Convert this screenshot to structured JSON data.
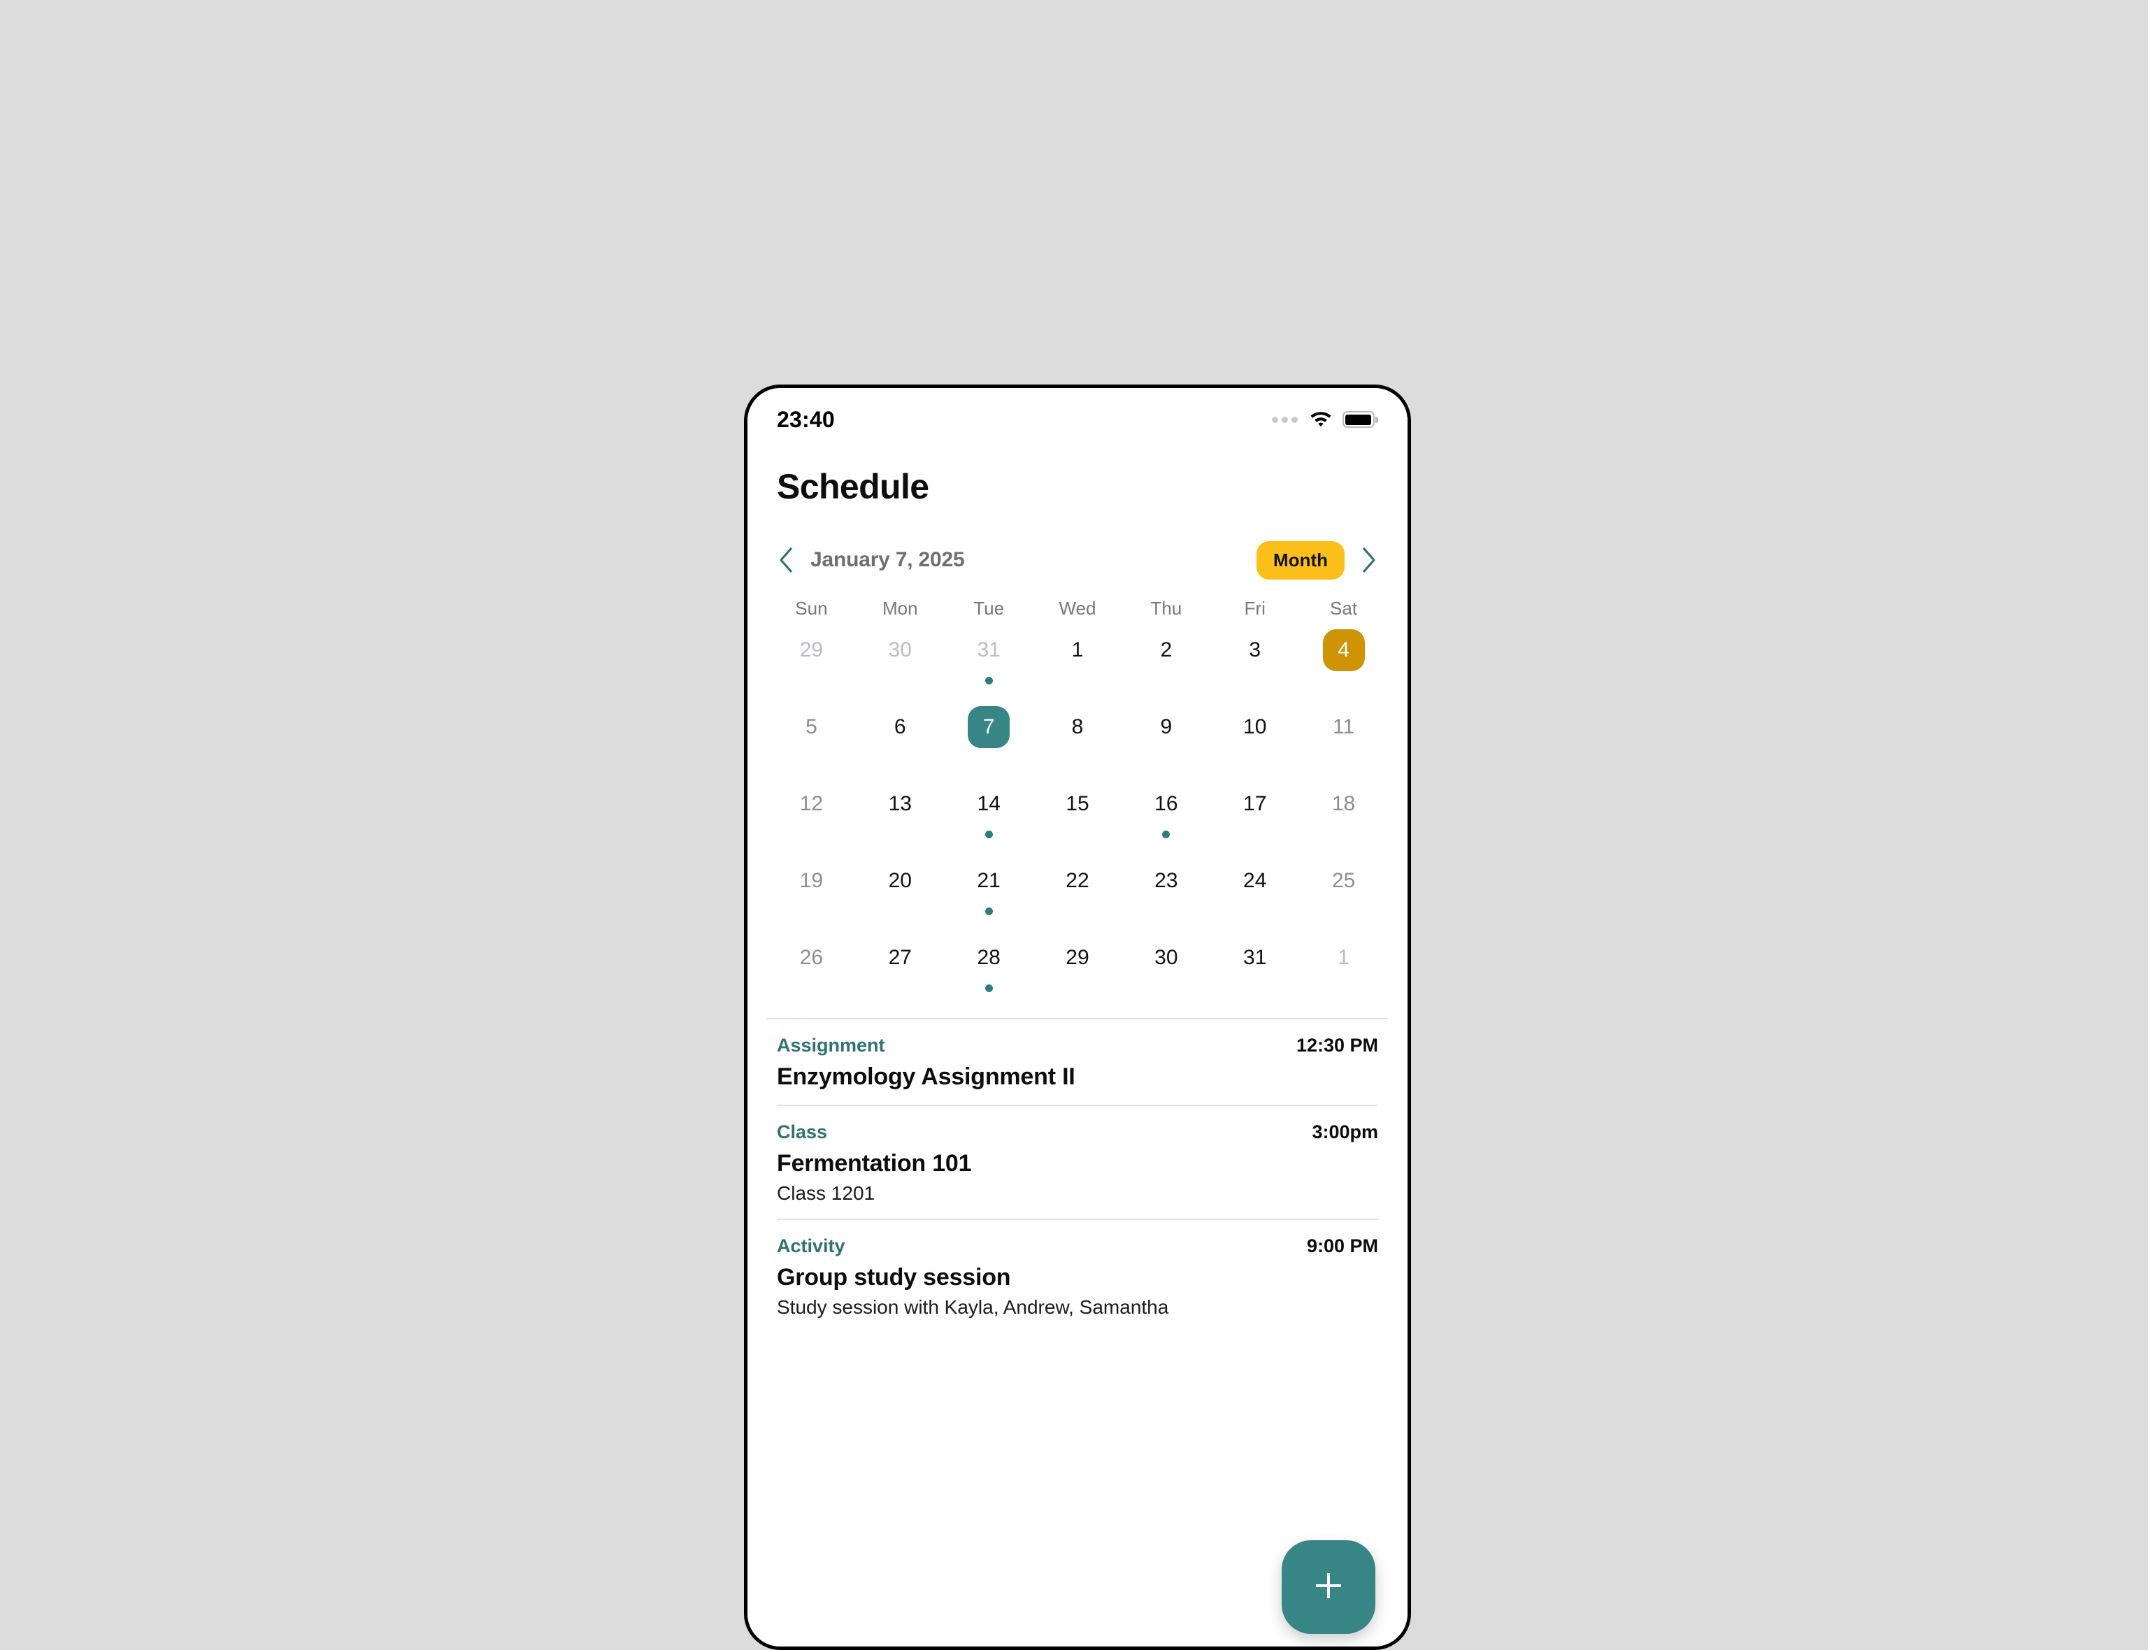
{
  "status_bar": {
    "time": "23:40",
    "signal_icon": "cellular-dots-icon",
    "wifi_icon": "wifi-icon",
    "battery_icon": "battery-full-icon"
  },
  "header": {
    "title": "Schedule"
  },
  "calendar": {
    "prev_icon": "chevron-left-icon",
    "next_icon": "chevron-right-icon",
    "month_label": "January 7, 2025",
    "view_mode": "Month",
    "weekdays": [
      "Sun",
      "Mon",
      "Tue",
      "Wed",
      "Thu",
      "Fri",
      "Sat"
    ],
    "weeks": [
      [
        {
          "day": "29",
          "state": "muted",
          "dot": false
        },
        {
          "day": "30",
          "state": "muted",
          "dot": false
        },
        {
          "day": "31",
          "state": "muted",
          "dot": true
        },
        {
          "day": "1",
          "state": "normal",
          "dot": false
        },
        {
          "day": "2",
          "state": "normal",
          "dot": false
        },
        {
          "day": "3",
          "state": "normal",
          "dot": false
        },
        {
          "day": "4",
          "state": "accent",
          "dot": false
        }
      ],
      [
        {
          "day": "5",
          "state": "weekend",
          "dot": false
        },
        {
          "day": "6",
          "state": "normal",
          "dot": false
        },
        {
          "day": "7",
          "state": "selected",
          "dot": false
        },
        {
          "day": "8",
          "state": "normal",
          "dot": false
        },
        {
          "day": "9",
          "state": "normal",
          "dot": false
        },
        {
          "day": "10",
          "state": "normal",
          "dot": false
        },
        {
          "day": "11",
          "state": "weekend",
          "dot": false
        }
      ],
      [
        {
          "day": "12",
          "state": "weekend",
          "dot": false
        },
        {
          "day": "13",
          "state": "normal",
          "dot": false
        },
        {
          "day": "14",
          "state": "normal",
          "dot": true
        },
        {
          "day": "15",
          "state": "normal",
          "dot": false
        },
        {
          "day": "16",
          "state": "normal",
          "dot": true
        },
        {
          "day": "17",
          "state": "normal",
          "dot": false
        },
        {
          "day": "18",
          "state": "weekend",
          "dot": false
        }
      ],
      [
        {
          "day": "19",
          "state": "weekend",
          "dot": false
        },
        {
          "day": "20",
          "state": "normal",
          "dot": false
        },
        {
          "day": "21",
          "state": "normal",
          "dot": true
        },
        {
          "day": "22",
          "state": "normal",
          "dot": false
        },
        {
          "day": "23",
          "state": "normal",
          "dot": false
        },
        {
          "day": "24",
          "state": "normal",
          "dot": false
        },
        {
          "day": "25",
          "state": "weekend",
          "dot": false
        }
      ],
      [
        {
          "day": "26",
          "state": "weekend",
          "dot": false
        },
        {
          "day": "27",
          "state": "normal",
          "dot": false
        },
        {
          "day": "28",
          "state": "normal",
          "dot": true
        },
        {
          "day": "29",
          "state": "normal",
          "dot": false
        },
        {
          "day": "30",
          "state": "normal",
          "dot": false
        },
        {
          "day": "31",
          "state": "normal",
          "dot": false
        },
        {
          "day": "1",
          "state": "muted",
          "dot": false
        }
      ]
    ]
  },
  "events": [
    {
      "kind": "Assignment",
      "time": "12:30 PM",
      "title": "Enzymology Assignment II",
      "subtitle": ""
    },
    {
      "kind": "Class",
      "time": "3:00pm",
      "title": "Fermentation 101",
      "subtitle": "Class 1201"
    },
    {
      "kind": "Activity",
      "time": "9:00 PM",
      "title": "Group study session",
      "subtitle": "Study session with Kayla, Andrew, Samantha"
    }
  ],
  "fab": {
    "icon": "plus-icon",
    "label": "Add event"
  },
  "colors": {
    "teal": "#378585",
    "teal_text": "#2f7272",
    "amber_pill": "#fcbf1a",
    "gold_badge": "#cf9406",
    "background": "#dcdcdc"
  }
}
